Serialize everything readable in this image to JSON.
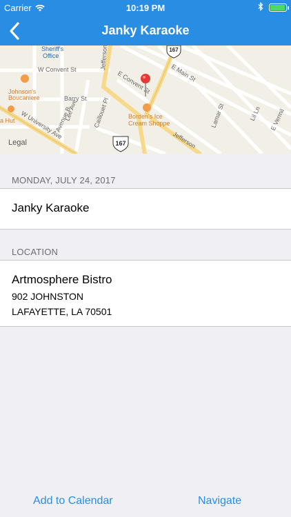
{
  "status": {
    "carrier": "Carrier",
    "time": "10:19 PM"
  },
  "nav": {
    "title": "Janky Karaoke"
  },
  "map": {
    "labels": {
      "sheriff": "Sheriff's\nOffice",
      "wconvent": "W Convent St",
      "johnsons": "Johnson's\nBoucaniere",
      "barry": "Barry St",
      "leeave": "Lee Ave",
      "calliouet": "Caillouet Pl",
      "avenue_b": "Avenue B",
      "wuniv": "W University Ave",
      "hut": "a Hut",
      "bordens": "Borden's Ice\nCream Shoppe",
      "econvent": "E Convent St",
      "jefferson": "Jefferson",
      "emain": "E Main St",
      "lamar": "Lamar St",
      "lilin": "Lil Ln",
      "evermil": "E Vermil",
      "route167": "167"
    },
    "legal": "Legal"
  },
  "event": {
    "date_header": "MONDAY, JULY 24, 2017",
    "name": "Janky Karaoke"
  },
  "location": {
    "header": "LOCATION",
    "venue": "Artmosphere Bistro",
    "address1": "902 JOHNSTON",
    "address2": "LAFAYETTE, LA 70501"
  },
  "toolbar": {
    "add_to_calendar": "Add to Calendar",
    "navigate": "Navigate"
  },
  "colors": {
    "accent": "#2a8de4",
    "pin": "#e53935",
    "road_major": "#f6d98b"
  }
}
